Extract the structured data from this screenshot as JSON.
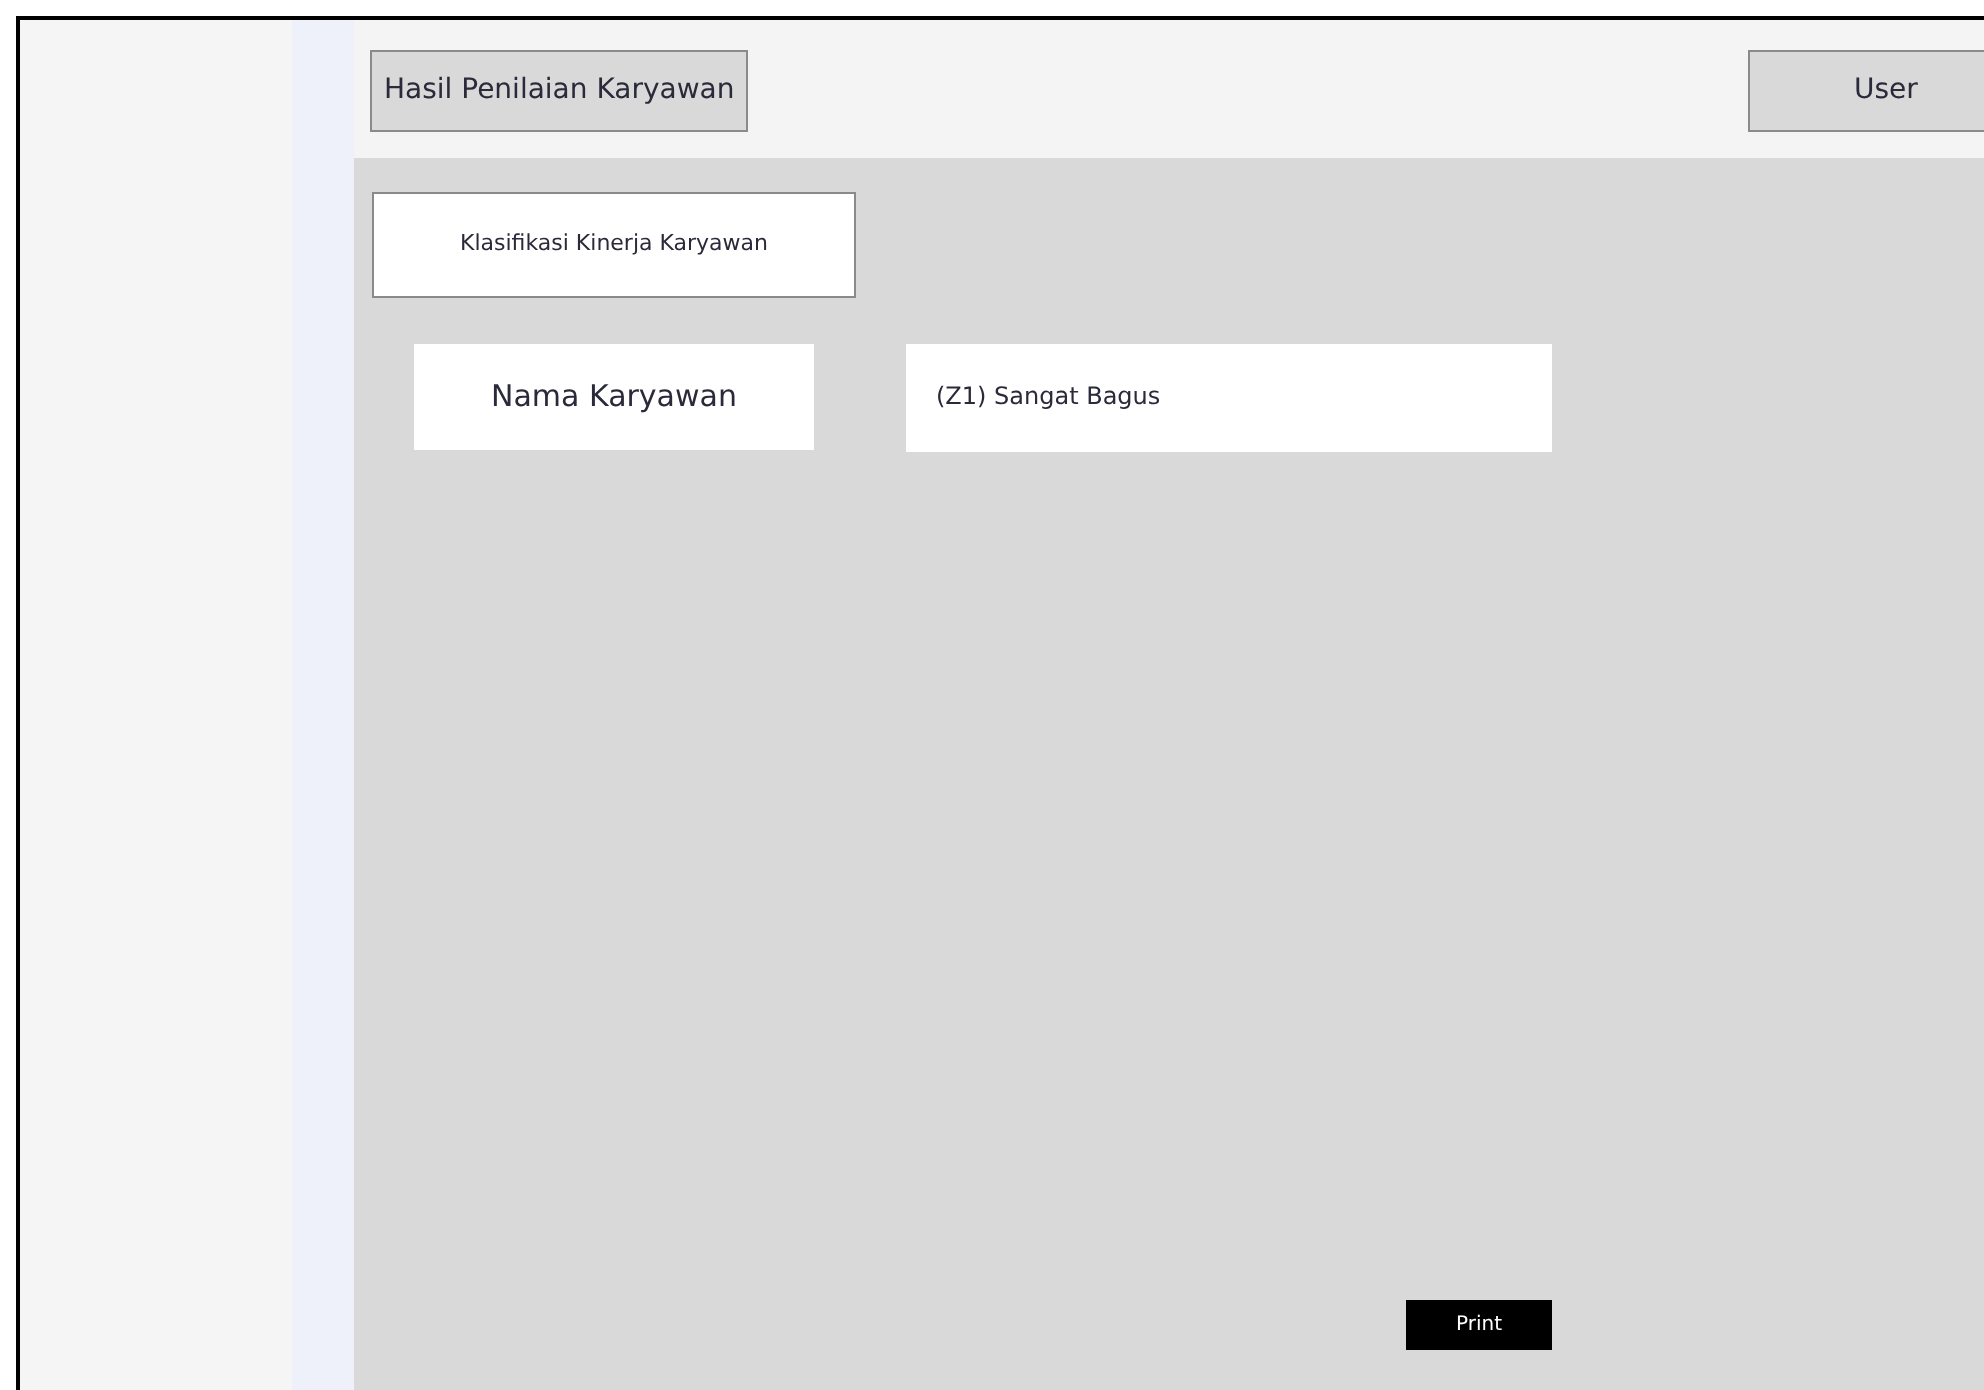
{
  "header": {
    "title": "Hasil Penilaian Karyawan",
    "user_button": "User"
  },
  "section": {
    "heading": "Klasifikasi Kinerja Karyawan"
  },
  "fields": [
    {
      "label": "Nama Karyawan",
      "value": "(Z1) Sangat Bagus"
    }
  ],
  "buttons": [
    {
      "label": "Print"
    }
  ]
}
